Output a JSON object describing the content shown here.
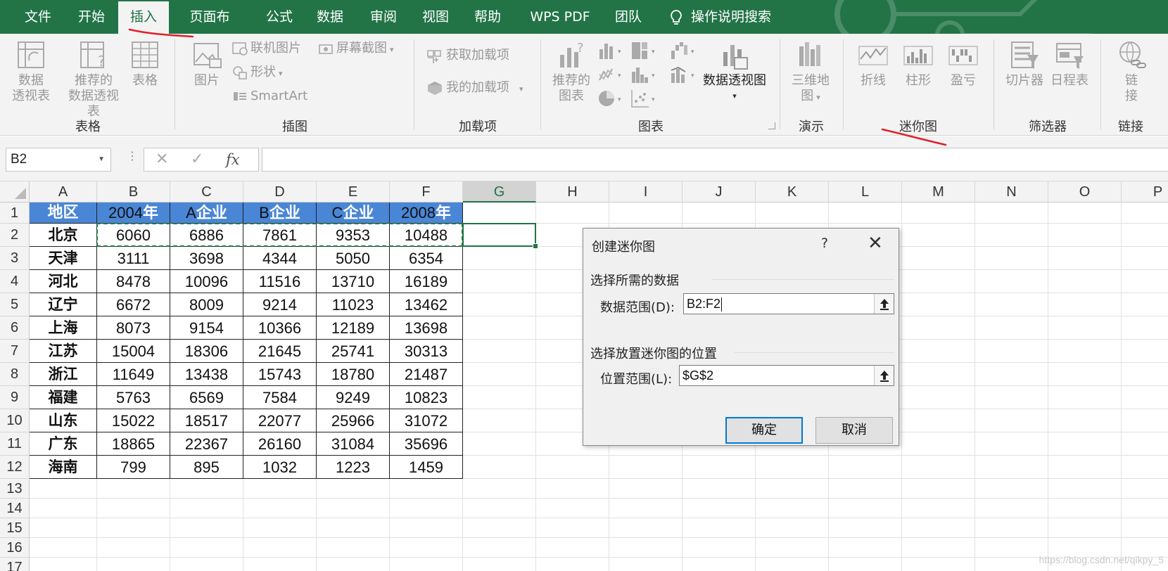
{
  "tabs": [
    {
      "label": "文件"
    },
    {
      "label": "开始"
    },
    {
      "label": "插入"
    },
    {
      "label": "页面布局"
    },
    {
      "label": "公式"
    },
    {
      "label": "数据"
    },
    {
      "label": "审阅"
    },
    {
      "label": "视图"
    },
    {
      "label": "帮助"
    },
    {
      "label": "WPS PDF"
    },
    {
      "label": "团队"
    },
    {
      "label": "操作说明搜索"
    }
  ],
  "active_tab": "插入",
  "ribbon": {
    "groups": {
      "tables": "表格",
      "illustrations": "插图",
      "addins": "加载项",
      "charts": "图表",
      "tours": "演示",
      "sparklines": "迷你图",
      "filters": "筛选器",
      "links": "链接"
    },
    "pivot_table": "数据\n透视表",
    "recommended_pivot": "推荐的\n数据透视表",
    "table": "表格",
    "pictures": "图片",
    "online_pictures": "联机图片",
    "shapes": "形状",
    "smartart": "SmartArt",
    "screenshot": "屏幕截图",
    "get_addins": "获取加载项",
    "my_addins": "我的加载项",
    "recommended_charts": "推荐的\n图表",
    "pivot_chart": "数据透视图",
    "map_3d": "三维地\n图",
    "spark_line": "折线",
    "spark_column": "柱形",
    "spark_winloss": "盈亏",
    "slicer": "切片器",
    "timeline": "日程表",
    "link": "链\n接"
  },
  "formula_bar": {
    "name_box": "B2",
    "fx": "fx",
    "value": ""
  },
  "sheet": {
    "columns": [
      "A",
      "B",
      "C",
      "D",
      "E",
      "F",
      "G",
      "H",
      "I",
      "J",
      "K",
      "L",
      "M",
      "N",
      "O",
      "P"
    ],
    "rows": [
      "1",
      "2",
      "3",
      "4",
      "5",
      "6",
      "7",
      "8",
      "9",
      "10",
      "11",
      "12",
      "13",
      "14",
      "15",
      "16",
      "17"
    ],
    "header": [
      "地区",
      "2004年",
      "A企业",
      "B企业",
      "C企业",
      "2008年"
    ],
    "data": [
      [
        "北京",
        "6060",
        "6886",
        "7861",
        "9353",
        "10488"
      ],
      [
        "天津",
        "3111",
        "3698",
        "4344",
        "5050",
        "6354"
      ],
      [
        "河北",
        "8478",
        "10096",
        "11516",
        "13710",
        "16189"
      ],
      [
        "辽宁",
        "6672",
        "8009",
        "9214",
        "11023",
        "13462"
      ],
      [
        "上海",
        "8073",
        "9154",
        "10366",
        "12189",
        "13698"
      ],
      [
        "江苏",
        "15004",
        "18306",
        "21645",
        "25741",
        "30313"
      ],
      [
        "浙江",
        "11649",
        "13438",
        "15743",
        "18780",
        "21487"
      ],
      [
        "福建",
        "5763",
        "6569",
        "7584",
        "9249",
        "10823"
      ],
      [
        "山东",
        "15022",
        "18517",
        "22077",
        "25966",
        "31072"
      ],
      [
        "广东",
        "18865",
        "22367",
        "26160",
        "31084",
        "35696"
      ],
      [
        "海南",
        "799",
        "895",
        "1032",
        "1223",
        "1459"
      ]
    ]
  },
  "dialog": {
    "title": "创建迷你图",
    "help": "?",
    "close": "✕",
    "section_data": "选择所需的数据",
    "data_range_label": "数据范围(D):",
    "data_range_value": "B2:F2",
    "section_location": "选择放置迷你图的位置",
    "location_label": "位置范围(L):",
    "location_value": "$G$2",
    "ok": "确定",
    "cancel": "取消"
  },
  "watermark": "https://blog.csdn.net/qikpy_5",
  "colors": {
    "excel_green": "#227447",
    "header_blue": "#4a86d6",
    "selection_green": "#217346",
    "pen_red": "#e0202a"
  }
}
